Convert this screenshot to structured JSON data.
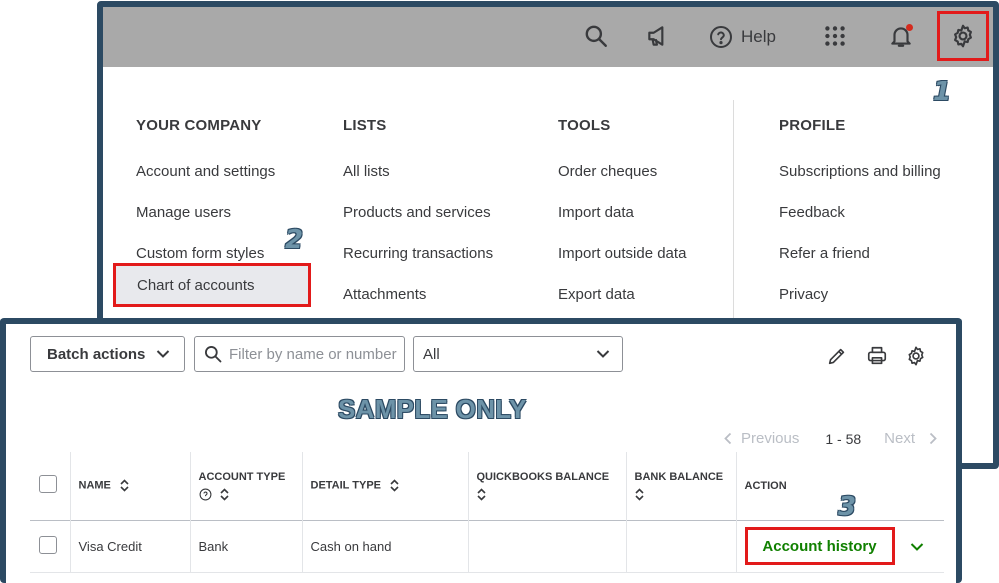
{
  "topbar": {
    "help_label": "Help",
    "icons": [
      "search-icon",
      "megaphone-icon",
      "help-icon",
      "apps-grid-icon",
      "notification-bell-icon",
      "gear-icon"
    ],
    "notification_dot_color": "#d52b1e"
  },
  "steps": {
    "one": "1",
    "two": "2",
    "three": "3"
  },
  "menu": {
    "your_company": {
      "heading": "YOUR COMPANY",
      "items": [
        "Account and settings",
        "Manage users",
        "Custom form styles",
        "Chart of accounts"
      ]
    },
    "lists": {
      "heading": "LISTS",
      "items": [
        "All lists",
        "Products and services",
        "Recurring transactions",
        "Attachments"
      ]
    },
    "tools": {
      "heading": "TOOLS",
      "items": [
        "Order cheques",
        "Import data",
        "Import outside data",
        "Export data"
      ]
    },
    "profile": {
      "heading": "PROFILE",
      "items": [
        "Subscriptions and billing",
        "Feedback",
        "Refer a friend",
        "Privacy"
      ]
    }
  },
  "toolbar": {
    "batch_actions": "Batch actions",
    "search_placeholder": "Filter by name or number",
    "filter_value": "All",
    "icons": [
      "edit-pencil-icon",
      "print-icon",
      "settings-gear-icon"
    ]
  },
  "watermark": "SAMPLE ONLY",
  "pager": {
    "previous": "Previous",
    "range": "1 - 58",
    "next": "Next"
  },
  "table": {
    "headers": {
      "name": "NAME",
      "account_type": "ACCOUNT TYPE",
      "detail_type": "DETAIL TYPE",
      "qb_balance": "QUICKBOOKS BALANCE",
      "bank_balance": "BANK BALANCE",
      "action": "ACTION"
    },
    "rows": [
      {
        "name": "Visa Credit",
        "account_type": "Bank",
        "detail_type": "Cash on hand",
        "qb_balance": "",
        "bank_balance": "",
        "action": "Account history"
      }
    ]
  },
  "colors": {
    "highlight": "#e21a1a",
    "panel_border": "#2c4a63",
    "action_green": "#108000",
    "topbar_gray": "#a9a9a9"
  }
}
